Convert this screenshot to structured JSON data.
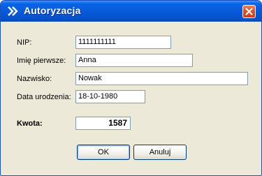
{
  "window": {
    "title": "Autoryzacja",
    "icon": "double-chevron-right-icon",
    "close_icon": "close-x-icon",
    "titlebar_color": "#0758d6",
    "close_color": "#d6542e"
  },
  "form": {
    "nip_label": "NIP:",
    "nip_value": "1111111111",
    "first_name_label": "Imię pierwsze:",
    "first_name_value": "Anna",
    "last_name_label": "Nazwisko:",
    "last_name_value": "Nowak",
    "birth_date_label": "Data urodzenia:",
    "birth_date_value": "18-10-1980",
    "amount_label": "Kwota:",
    "amount_value": "1587"
  },
  "buttons": {
    "ok_label": "OK",
    "cancel_label": "Anuluj"
  }
}
